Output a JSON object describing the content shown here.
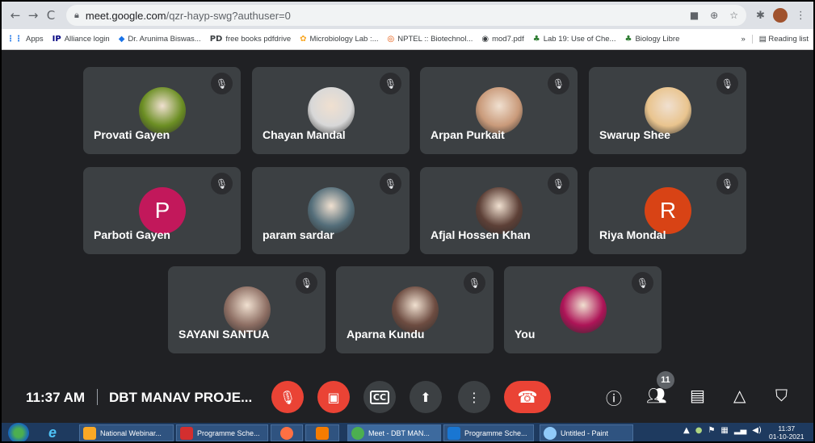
{
  "browser": {
    "nav": {
      "back": "←",
      "forward": "→",
      "reload": "C"
    },
    "url_host": "meet.google.com",
    "url_path": "/qzr-hayp-swg?authuser=0",
    "bookmarks": [
      {
        "label": "Apps",
        "icon": "⋮⋮",
        "color": "#1a73e8"
      },
      {
        "label": "Alliance login",
        "icon": "IP",
        "color": "#000080"
      },
      {
        "label": "Dr. Arunima Biswas...",
        "icon": "◆",
        "color": "#1a73e8"
      },
      {
        "label": "free books pdfdrive",
        "icon": "PD",
        "color": "#000"
      },
      {
        "label": "Microbiology Lab :...",
        "icon": "✿",
        "color": "#f9a825"
      },
      {
        "label": "NPTEL :: Biotechnol...",
        "icon": "◎",
        "color": "#e65100"
      },
      {
        "label": "mod7.pdf",
        "icon": "◉",
        "color": "#333"
      },
      {
        "label": "Lab 19: Use of Che...",
        "icon": "♣",
        "color": "#2e7d32"
      },
      {
        "label": "Biology Libre",
        "icon": "♣",
        "color": "#2e7d32"
      }
    ],
    "more": "»",
    "reading_list": "Reading list"
  },
  "participants": [
    {
      "name": "Provati Gayen",
      "avatar": "photo-flower",
      "color": "#6b8e23"
    },
    {
      "name": "Chayan Mandal",
      "avatar": "photo-person",
      "color": "#d8d8d8"
    },
    {
      "name": "Arpan Purkait",
      "avatar": "photo-person",
      "color": "#c99a7a"
    },
    {
      "name": "Swarup Shee",
      "avatar": "photo-book",
      "color": "#e9c48e"
    },
    {
      "name": "Parboti Gayen",
      "avatar": "letter",
      "letter": "P",
      "color": "#c2185b"
    },
    {
      "name": "param sardar",
      "avatar": "photo-tree",
      "color": "#546e7a"
    },
    {
      "name": "Afjal Hossen Khan",
      "avatar": "photo-person",
      "color": "#5d4037"
    },
    {
      "name": "Riya Mondal",
      "avatar": "letter",
      "letter": "R",
      "color": "#d84315"
    },
    {
      "name": "SAYANI SANTUA",
      "avatar": "photo-sunset",
      "color": "#8d6e63"
    },
    {
      "name": "Aparna Kundu",
      "avatar": "photo-person",
      "color": "#6d4c41"
    },
    {
      "name": "You",
      "avatar": "photo-person",
      "color": "#ad1457"
    }
  ],
  "controls": {
    "time": "11:37 AM",
    "meeting_title": "DBT MANAV PROJE...",
    "people_count": "11",
    "icons": {
      "mic": "mic-off-icon",
      "cam": "camera-off-icon",
      "cc": "CC",
      "present": "present-icon",
      "more": "⋮",
      "end": "end-call-icon",
      "info": "ⓘ",
      "chat": "chat-icon",
      "activities": "activities-icon",
      "safety": "host-controls-icon"
    }
  },
  "taskbar": {
    "items": [
      {
        "label": "National Webinar...",
        "color": "#f9a825"
      },
      {
        "label": "Programme Sche...",
        "color": "#d32f2f"
      },
      {
        "label": "",
        "color": "#ff7043"
      },
      {
        "label": "",
        "color": "#f57c00"
      },
      {
        "label": "Meet - DBT MAN...",
        "color": "#4caf50"
      },
      {
        "label": "Programme Sche...",
        "color": "#1976d2"
      },
      {
        "label": "Untitled - Paint",
        "color": "#90caf9"
      }
    ],
    "clock_time": "11:37",
    "clock_date": "01-10-2021"
  }
}
